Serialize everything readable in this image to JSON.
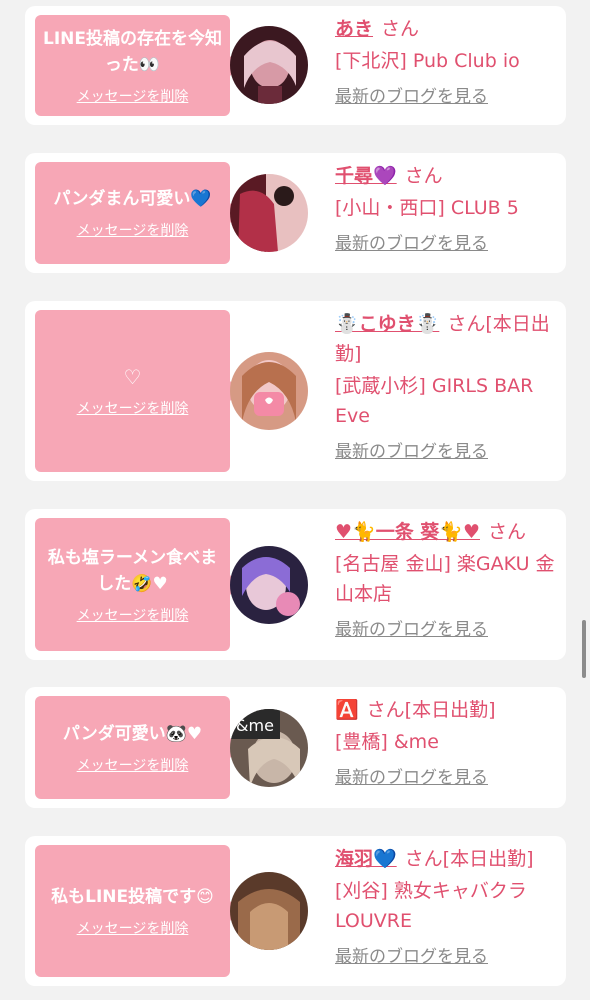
{
  "delete_label": "メッセージを削除",
  "blog_label": "最新のブログを見る",
  "colors": {
    "bubble": "#f7a7b6",
    "accent": "#e0506f",
    "link_gray": "#8a8a8a"
  },
  "cards": [
    {
      "message": "LINE投稿の存在を今知った👀",
      "name": "あき",
      "suffix": "さん",
      "shop": "[下北沢] Pub Club io",
      "avatar_colors": [
        "#3b1820",
        "#d79aa6",
        "#6b2b3a"
      ]
    },
    {
      "message": "パンダまん可愛い💙",
      "name": "千尋💜",
      "suffix": "さん",
      "shop": "[小山・西口] CLUB 5",
      "avatar_colors": [
        "#b23048",
        "#5a1a24",
        "#e8c0c0"
      ]
    },
    {
      "message": "♡",
      "name": "☃️こゆき☃️",
      "suffix": "さん[本日出勤]",
      "shop": "[武蔵小杉] GIRLS BAR Eve",
      "avatar_colors": [
        "#f2c8c8",
        "#f48aa6",
        "#d69a84"
      ]
    },
    {
      "message": "私も塩ラーメン食べました🤣♥",
      "name": "♥🐈一条 葵🐈♥",
      "suffix": "さん",
      "shop": "[名古屋 金山] 楽GAKU 金山本店",
      "avatar_colors": [
        "#2a2240",
        "#8b6cd6",
        "#e88ab6"
      ]
    },
    {
      "message": "パンダ可愛い🐼♥",
      "name": "🅰️",
      "suffix": "さん[本日出勤]",
      "shop": "[豊橋] &me",
      "avatar_colors": [
        "#6a5a50",
        "#c8b6a8",
        "#2a2a2a"
      ],
      "avatar_text": "&me"
    },
    {
      "message": "私もLINE投稿です😊",
      "name": "海羽💙",
      "suffix": "さん[本日出勤]",
      "shop": "[刈谷] 熟女キャバクラ LOUVRE",
      "avatar_colors": [
        "#9a6a4a",
        "#c89a74",
        "#5a3a2a"
      ]
    }
  ]
}
